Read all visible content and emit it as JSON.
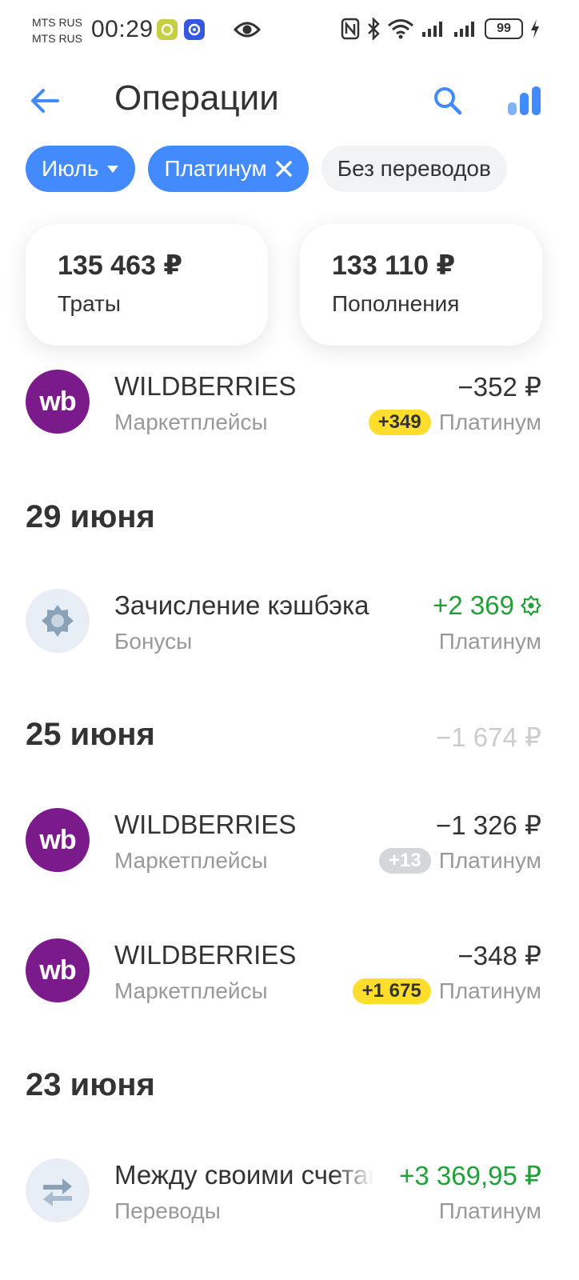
{
  "status_bar": {
    "carrier_1": "MTS RUS",
    "carrier_2": "MTS RUS",
    "time": "00:29",
    "battery": "99"
  },
  "header": {
    "title": "Операции"
  },
  "filters": {
    "month": "Июль",
    "card": "Платинум",
    "no_transfers": "Без переводов"
  },
  "summary": {
    "spending_amount": "135 463 ₽",
    "spending_label": "Траты",
    "income_amount": "133 110 ₽",
    "income_label": "Пополнения"
  },
  "operations": [
    {
      "name": "WILDBERRIES",
      "category": "Маркетплейсы",
      "amount": "−352 ₽",
      "bonus": "+349",
      "account": "Платинум",
      "icon": "wb"
    },
    {
      "name": "Зачисление кэшбэка",
      "category": "Бонусы",
      "amount": "+2 369",
      "account": "Платинум",
      "icon": "cashback-icon"
    },
    {
      "name": "WILDBERRIES",
      "category": "Маркетплейсы",
      "amount": "−1 326 ₽",
      "bonus": "+13",
      "account": "Платинум",
      "icon": "wb"
    },
    {
      "name": "WILDBERRIES",
      "category": "Маркетплейсы",
      "amount": "−348 ₽",
      "bonus": "+1 675",
      "account": "Платинум",
      "icon": "wb"
    },
    {
      "name": "Между своими счетами",
      "category": "Переводы",
      "amount": "+3 369,95 ₽",
      "account": "Платинум",
      "icon": "transfer-icon"
    }
  ],
  "dates": [
    {
      "label": "29 июня"
    },
    {
      "label": "25 июня",
      "total": "−1 674 ₽"
    },
    {
      "label": "23 июня"
    }
  ],
  "logo_text": "wb",
  "colors": {
    "accent": "#448aff",
    "income": "#21a038",
    "wb_brand": "#7b1a8a",
    "bonus_badge": "#ffdd2d"
  }
}
